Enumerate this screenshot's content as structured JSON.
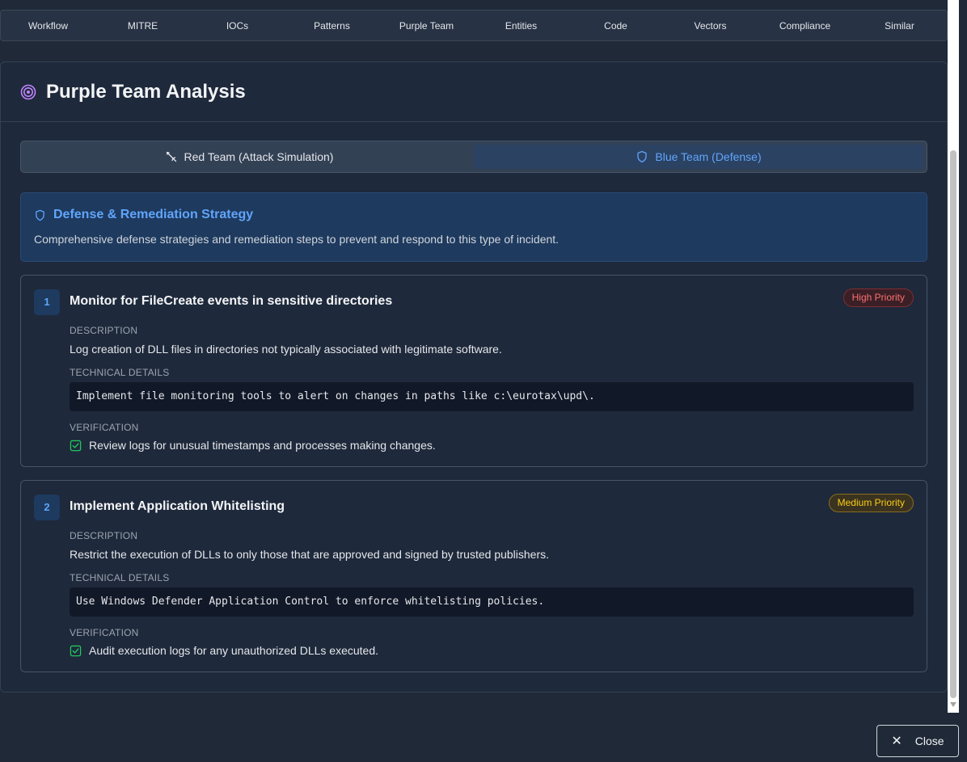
{
  "tabs": [
    "Workflow",
    "MITRE",
    "IOCs",
    "Patterns",
    "Purple Team",
    "Entities",
    "Code",
    "Vectors",
    "Compliance",
    "Similar"
  ],
  "panel": {
    "title": "Purple Team Analysis",
    "icon": "target-icon"
  },
  "toggle": {
    "red_label": "Red Team (Attack Simulation)",
    "blue_label": "Blue Team (Defense)",
    "active": "blue"
  },
  "strategy": {
    "title": "Defense & Remediation Strategy",
    "text": "Comprehensive defense strategies and remediation steps to prevent and respond to this type of incident."
  },
  "labels": {
    "description": "DESCRIPTION",
    "technical": "TECHNICAL DETAILS",
    "verification": "VERIFICATION"
  },
  "items": [
    {
      "num": "1",
      "title": "Monitor for FileCreate events in sensitive directories",
      "priority": "High Priority",
      "description": "Log creation of DLL files in directories not typically associated with legitimate software.",
      "technical": "Implement file monitoring tools to alert on changes in paths like c:\\eurotax\\upd\\.",
      "verification": "Review logs for unusual timestamps and processes making changes."
    },
    {
      "num": "2",
      "title": "Implement Application Whitelisting",
      "priority": "Medium Priority",
      "description": "Restrict the execution of DLLs to only those that are approved and signed by trusted publishers.",
      "technical": "Use Windows Defender Application Control to enforce whitelisting policies.",
      "verification": "Audit execution logs for any unauthorized DLLs executed."
    }
  ],
  "close_label": "Close",
  "colors": {
    "accent_blue": "#60a5fa",
    "high": "#f87171",
    "medium": "#facc15",
    "check": "#22c55e",
    "target": "#c084fc"
  }
}
